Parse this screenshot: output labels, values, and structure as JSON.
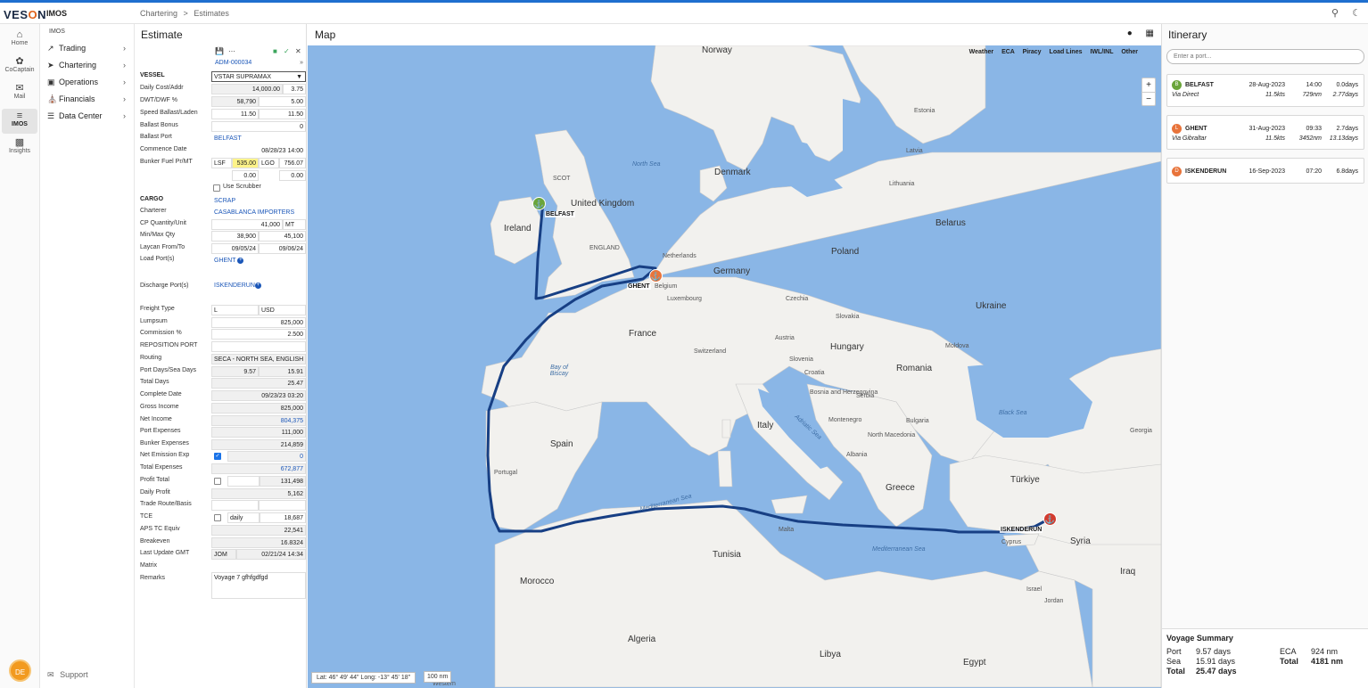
{
  "app": {
    "logo": "VESON",
    "logo_o": "O",
    "name": "IMOS",
    "breadcrumb_1": "Chartering",
    "breadcrumb_sep": ">",
    "breadcrumb_2": "Estimates"
  },
  "rail": [
    {
      "label": "Home",
      "icon": "home-icon"
    },
    {
      "label": "CoCaptain",
      "icon": "cocaptain-icon"
    },
    {
      "label": "Mail",
      "icon": "mail-icon"
    },
    {
      "label": "IMOS",
      "icon": "imos-icon"
    },
    {
      "label": "Insights",
      "icon": "insights-icon"
    }
  ],
  "avatar": "DE",
  "nav": {
    "heading": "IMOS",
    "items": [
      {
        "label": "Trading",
        "icon": "trading-icon"
      },
      {
        "label": "Chartering",
        "icon": "chartering-icon"
      },
      {
        "label": "Operations",
        "icon": "operations-icon"
      },
      {
        "label": "Financials",
        "icon": "financials-icon"
      },
      {
        "label": "Data Center",
        "icon": "data-center-icon"
      }
    ],
    "support": "Support"
  },
  "estimate": {
    "title": "Estimate",
    "id": "ADM-000034",
    "vessel_section": "VESSEL",
    "vessel_name": "VSTAR SUPRAMAX",
    "daily_cost_label": "Daily Cost/Addr",
    "daily_cost": "14,000.00",
    "daily_addr": "3.75",
    "dwt_label": "DWT/DWF %",
    "dwt": "58,790",
    "dwf": "5.00",
    "speed_label": "Speed Ballast/Laden",
    "speed_ballast": "11.50",
    "speed_laden": "11.50",
    "ballast_bonus_label": "Ballast Bonus",
    "ballast_bonus": "0",
    "ballast_port_label": "Ballast Port",
    "ballast_port": "BELFAST",
    "commence_label": "Commence Date",
    "commence": "08/28/23 14:00",
    "bunker_label": "Bunker Fuel Pr/MT",
    "lsf_label": "LSF",
    "lsf_val": "535.00",
    "lgo_label": "LGO",
    "lgo_val": "756.07",
    "bunker_a": "0.00",
    "bunker_b": "0.00",
    "scrubber_label": "Use Scrubber",
    "cargo_section": "CARGO",
    "cargo": "SCRAP",
    "charterer_label": "Charterer",
    "charterer": "CASABLANCA IMPORTERS",
    "cp_qty_label": "CP Quantity/Unit",
    "cp_qty": "41,000",
    "cp_unit": "MT",
    "minmax_label": "Min/Max Qty",
    "min_qty": "38,900",
    "max_qty": "45,100",
    "laycan_label": "Laycan From/To",
    "laycan_from": "09/05/24",
    "laycan_to": "09/06/24",
    "load_port_label": "Load Port(s)",
    "load_port": "GHENT",
    "discharge_port_label": "Discharge Port(s)",
    "discharge_port": "ISKENDERUN",
    "freight_type_label": "Freight Type",
    "freight_type": "L",
    "freight_currency": "USD",
    "lumpsum_label": "Lumpsum",
    "lumpsum": "825,000",
    "commission_label": "Commission %",
    "commission": "2.500",
    "reposition_label": "REPOSITION PORT",
    "routing_label": "Routing",
    "routing": "SECA - NORTH SEA, ENGLISH",
    "port_sea_label": "Port Days/Sea Days",
    "port_days": "9.57",
    "sea_days": "15.91",
    "total_days_label": "Total Days",
    "total_days": "25.47",
    "complete_label": "Complete Date",
    "complete": "09/23/23 03:20",
    "gross_label": "Gross Income",
    "gross": "825,000",
    "net_income_label": "Net Income",
    "net_income": "804,375",
    "port_exp_label": "Port Expenses",
    "port_exp": "111,000",
    "bunker_exp_label": "Bunker Expenses",
    "bunker_exp": "214,859",
    "net_emission_label": "Net Emission Exp",
    "net_emission": "0",
    "total_exp_label": "Total Expenses",
    "total_exp": "672,877",
    "profit_label": "Profit Total",
    "profit": "131,498",
    "daily_profit_label": "Daily Profit",
    "daily_profit": "5,162",
    "trade_route_label": "Trade Route/Basis",
    "tce_label": "TCE",
    "tce_basis": "daily",
    "tce": "18,687",
    "aps_label": "APS TC Equiv",
    "aps": "22,541",
    "breakeven_label": "Breakeven",
    "breakeven": "16.8324",
    "last_update_label": "Last Update GMT",
    "last_update_user": "JOM",
    "last_update": "02/21/24 14:34",
    "matrix_label": "Matrix",
    "remarks_label": "Remarks",
    "remarks": "Voyage 7 gfhfgdfgd"
  },
  "map": {
    "title": "Map",
    "layers": [
      "Weather",
      "ECA",
      "Piracy",
      "Load Lines",
      "IWL/INL",
      "Other"
    ],
    "zoom_in": "+",
    "zoom_out": "−",
    "coords": "Lat: 46° 49' 44\"  Long: -13° 45' 18\"",
    "scale": "100 nm",
    "countries": [
      "Norway",
      "Denmark",
      "United Kingdom",
      "Ireland",
      "Netherlands",
      "Germany",
      "Poland",
      "Belarus",
      "Ukraine",
      "France",
      "Hungary",
      "Romania",
      "Spain",
      "Italy",
      "Greece",
      "Türkiye",
      "Syria",
      "Tunisia",
      "Morocco",
      "Algeria",
      "Libya",
      "Egypt",
      "Iraq",
      "Lithuania",
      "Latvia",
      "Estonia",
      "Belgium",
      "Luxembourg",
      "Czechia",
      "Slovakia",
      "Austria",
      "Switzerland",
      "Slovenia",
      "Croatia",
      "Serbia",
      "Bosnia and Herzegovina",
      "Montenegro",
      "Albania",
      "North Macedonia",
      "Bulgaria",
      "Moldova",
      "Portugal",
      "Cyprus",
      "Jordan",
      "Israel",
      "Georgia",
      "Malta",
      "Western",
      "SCOT",
      "ENGLAND"
    ],
    "seas": [
      "North Sea",
      "Bay of Biscay",
      "Mediterranean Sea",
      "Adriatic Sea",
      "Black Sea",
      "Mediterranean Sea"
    ],
    "ports": [
      {
        "name": "BELFAST",
        "type": "ballast",
        "color": "#6aa53a"
      },
      {
        "name": "GHENT",
        "type": "load",
        "color": "#e8743b"
      },
      {
        "name": "ISKENDERUN",
        "type": "discharge",
        "color": "#d23b2e"
      }
    ]
  },
  "itinerary": {
    "title": "Itinerary",
    "search_placeholder": "Enter a port...",
    "stops": [
      {
        "badge": "B",
        "port": "BELFAST",
        "date": "28-Aug-2023",
        "time": "14:00",
        "days": "0.0days",
        "via": "Via Direct",
        "speed": "11.5kts",
        "dist": "729nm",
        "sea_days": "2.77days",
        "color": "#6aa53a"
      },
      {
        "badge": "L",
        "port": "GHENT",
        "date": "31-Aug-2023",
        "time": "09:33",
        "days": "2.7days",
        "via": "Via Gibraltar",
        "speed": "11.5kts",
        "dist": "3452nm",
        "sea_days": "13.13days",
        "color": "#e8743b"
      },
      {
        "badge": "D",
        "port": "ISKENDERUN",
        "date": "16-Sep-2023",
        "time": "07:20",
        "days": "6.8days",
        "via": "",
        "speed": "",
        "dist": "",
        "sea_days": "",
        "color": "#e8743b"
      }
    ],
    "summary": {
      "title": "Voyage Summary",
      "port_label": "Port",
      "port": "9.57 days",
      "sea_label": "Sea",
      "sea": "15.91 days",
      "total_label": "Total",
      "total": "25.47 days",
      "eca_label": "ECA",
      "eca": "924 nm",
      "total_dist_label": "Total",
      "total_dist": "4181 nm"
    }
  }
}
